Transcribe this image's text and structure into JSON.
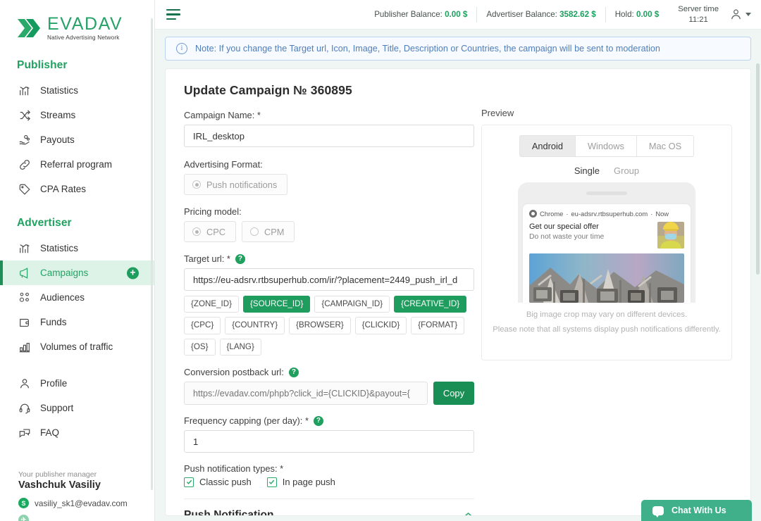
{
  "brand": {
    "name": "EVADAV",
    "tagline": "Native Advertising Network",
    "accent": "#1f9d5e",
    "accent_dark": "#16724a"
  },
  "sidebar": {
    "publisher_title": "Publisher",
    "publisher_items": [
      {
        "label": "Statistics",
        "icon": "bar-chart-icon"
      },
      {
        "label": "Streams",
        "icon": "shuffle-icon"
      },
      {
        "label": "Payouts",
        "icon": "hand-coins-icon"
      },
      {
        "label": "Referral program",
        "icon": "link-icon"
      },
      {
        "label": "CPA Rates",
        "icon": "tag-icon"
      }
    ],
    "advertiser_title": "Advertiser",
    "advertiser_items": [
      {
        "label": "Statistics",
        "icon": "bar-chart-icon",
        "active": false
      },
      {
        "label": "Campaigns",
        "icon": "megaphone-icon",
        "active": true,
        "action": "+"
      },
      {
        "label": "Audiences",
        "icon": "users-icon",
        "active": false
      },
      {
        "label": "Funds",
        "icon": "wallet-icon",
        "active": false
      },
      {
        "label": "Volumes of traffic",
        "icon": "bars-icon",
        "active": false
      }
    ],
    "account_items": [
      {
        "label": "Profile",
        "icon": "person-icon"
      },
      {
        "label": "Support",
        "icon": "headset-icon"
      },
      {
        "label": "FAQ",
        "icon": "chat-question-icon"
      }
    ],
    "manager": {
      "caption": "Your publisher manager",
      "name": "Vashchuk Vasiliy",
      "skype": "vasiliy_sk1@evadav.com"
    }
  },
  "topbar": {
    "publisher_balance_label": "Publisher Balance:",
    "publisher_balance_value": "0.00 $",
    "advertiser_balance_label": "Advertiser Balance:",
    "advertiser_balance_value": "3582.62 $",
    "hold_label": "Hold:",
    "hold_value": "0.00 $",
    "server_time_label": "Server time",
    "server_time_value": "11:21"
  },
  "note": {
    "text": "Note: If you change the Target url, Icon, Image, Title, Description or Countries, the campaign will be sent to moderation"
  },
  "form": {
    "title": "Update Campaign № 360895",
    "campaign_name_label": "Campaign Name: *",
    "campaign_name_value": "IRL_desktop",
    "ad_format_label": "Advertising Format:",
    "ad_format_options": [
      {
        "label": "Push notifications",
        "selected": true
      }
    ],
    "pricing_label": "Pricing model:",
    "pricing_options": [
      {
        "label": "CPC",
        "selected": true
      },
      {
        "label": "CPM",
        "selected": false
      }
    ],
    "target_url_label": "Target url: *",
    "target_url_value": "https://eu-adsrv.rtbsuperhub.com/ir/?placement=2449_push_irl_d",
    "macros": [
      {
        "label": "{ZONE_ID}",
        "selected": false
      },
      {
        "label": "{SOURCE_ID}",
        "selected": true
      },
      {
        "label": "{CAMPAIGN_ID}",
        "selected": false
      },
      {
        "label": "{CREATIVE_ID}",
        "selected": true
      },
      {
        "label": "{CPC}",
        "selected": false
      },
      {
        "label": "{COUNTRY}",
        "selected": false
      },
      {
        "label": "{BROWSER}",
        "selected": false
      },
      {
        "label": "{CLICKID}",
        "selected": false
      },
      {
        "label": "{FORMAT}",
        "selected": false
      },
      {
        "label": "{OS}",
        "selected": false
      },
      {
        "label": "{LANG}",
        "selected": false
      }
    ],
    "postback_label": "Conversion postback url:",
    "postback_placeholder": "https://evadav.com/phpb?click_id={CLICKID}&payout={",
    "copy_label": "Copy",
    "frequency_label": "Frequency capping (per day): *",
    "frequency_value": "1",
    "push_types_label": "Push notification types: *",
    "push_types": [
      {
        "label": "Classic push",
        "checked": true
      },
      {
        "label": "In page push",
        "checked": true
      }
    ],
    "accordion_title": "Push Notification"
  },
  "preview": {
    "label": "Preview",
    "os_tabs": [
      {
        "label": "Android",
        "active": true
      },
      {
        "label": "Windows",
        "active": false
      },
      {
        "label": "Mac OS",
        "active": false
      }
    ],
    "mode_tabs": [
      {
        "label": "Single",
        "active": true
      },
      {
        "label": "Group",
        "active": false
      }
    ],
    "push": {
      "browser": "Chrome",
      "domain": "eu-adsrv.rtbsuperhub.com",
      "time": "Now",
      "separator": "·",
      "title": "Get our special offer",
      "description": "Do not waste your time"
    },
    "note_1": "Big image crop may vary on different devices.",
    "note_2": "Please note that all systems display push notifications differently."
  },
  "chat": {
    "label": "Chat With Us",
    "color": "#3fb08a"
  }
}
